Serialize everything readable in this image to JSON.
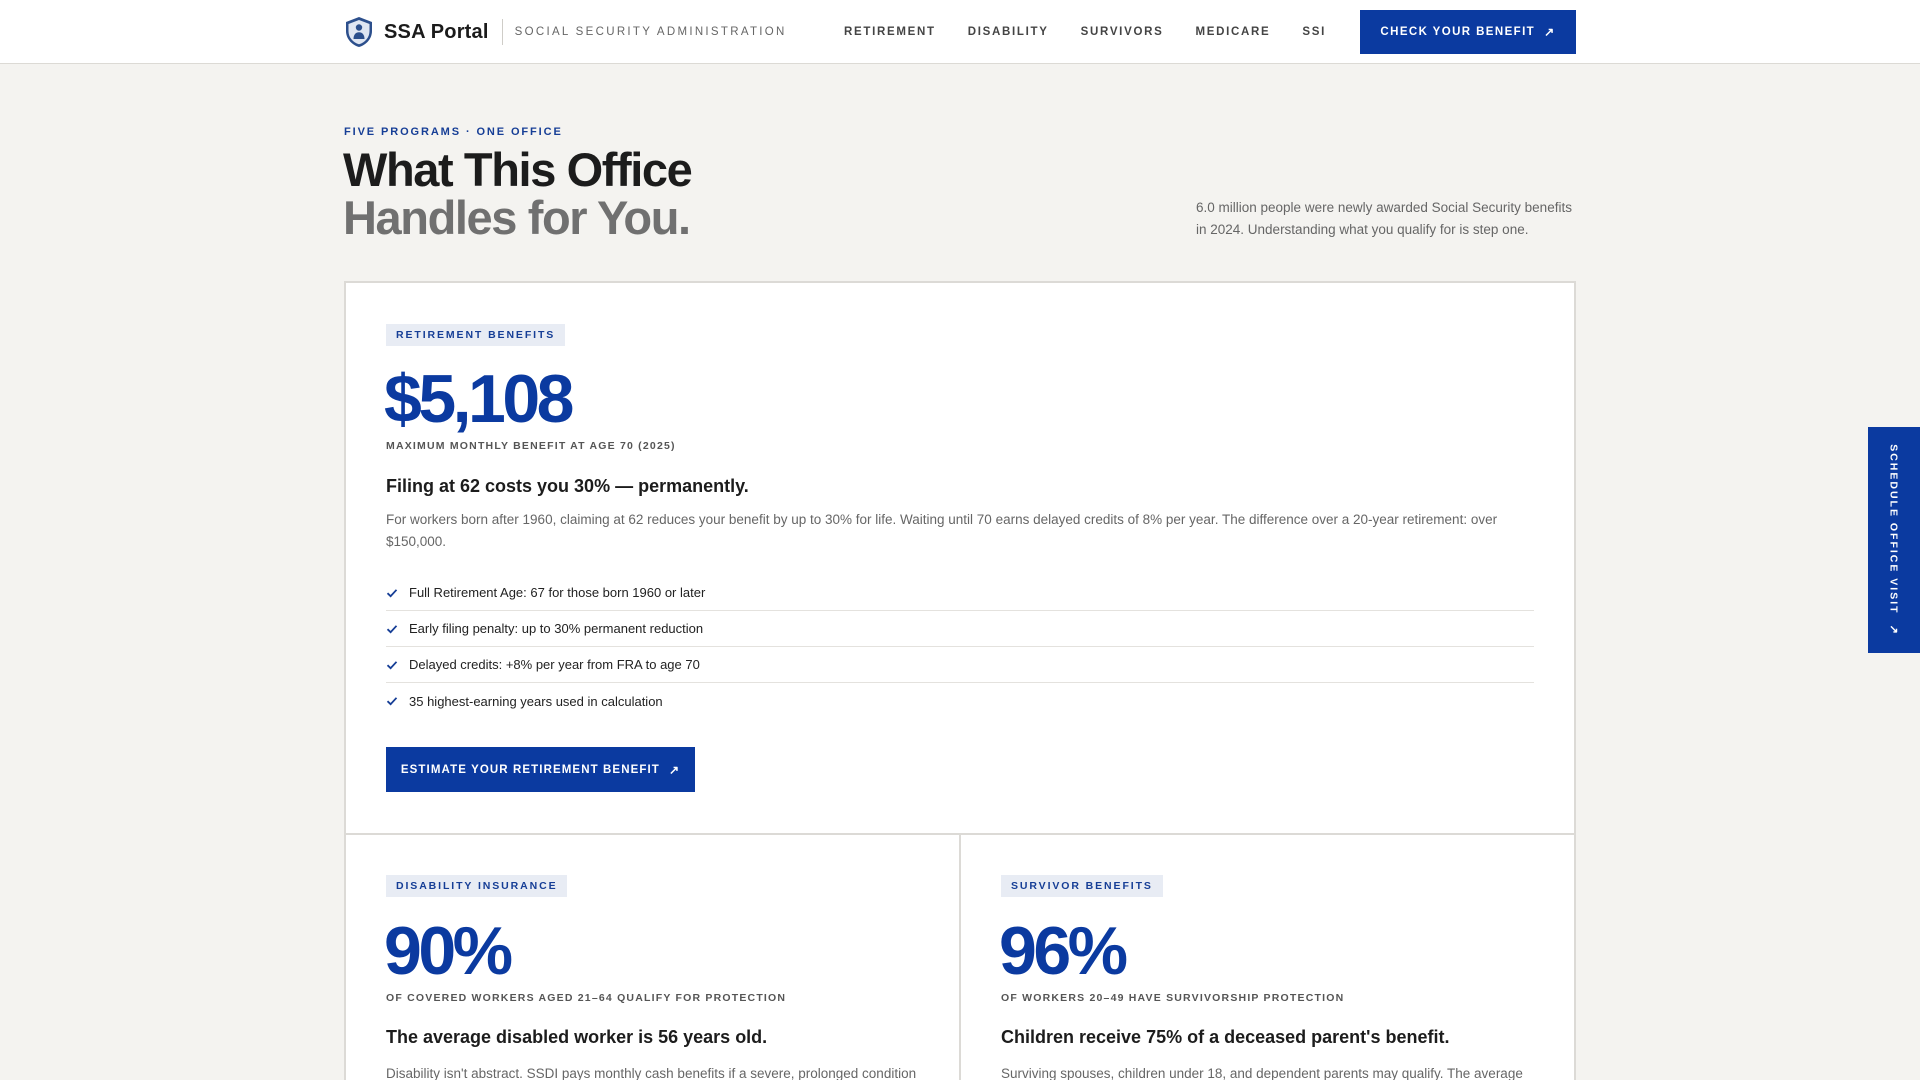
{
  "header": {
    "brand_name": "SSA Portal",
    "brand_subtitle": "SOCIAL SECURITY ADMINISTRATION",
    "logo_icon": "shield-person-icon",
    "nav": [
      "RETIREMENT",
      "DISABILITY",
      "SURVIVORS",
      "MEDICARE",
      "SSI"
    ],
    "cta_label": "CHECK YOUR BENEFIT",
    "cta_icon": "arrow-up-right-icon"
  },
  "hero": {
    "eyebrow": "FIVE PROGRAMS · ONE OFFICE",
    "title_line1": "What This Office",
    "title_line2": "Handles for You.",
    "intro": "6.0 million people were newly awarded Social Security benefits in 2024. Understanding what you qualify for is step one."
  },
  "cards": {
    "retirement": {
      "tag": "RETIREMENT BENEFITS",
      "stat": "$5,108",
      "stat_caption": "MAXIMUM MONTHLY BENEFIT AT AGE 70 (2025)",
      "headline": "Filing at 62 costs you 30% — permanently.",
      "body": "For workers born after 1960, claiming at 62 reduces your benefit by up to 30% for life. Waiting until 70 earns delayed credits of 8% per year. The difference over a 20-year retirement: over $150,000.",
      "checklist": [
        "Full Retirement Age: 67 for those born 1960 or later",
        "Early filing penalty: up to 30% permanent reduction",
        "Delayed credits: +8% per year from FRA to age 70",
        "35 highest-earning years used in calculation"
      ],
      "cta_label": "ESTIMATE YOUR RETIREMENT BENEFIT"
    },
    "disability": {
      "tag": "DISABILITY INSURANCE",
      "stat": "90%",
      "stat_caption": "OF COVERED WORKERS AGED 21–64 QUALIFY FOR PROTECTION",
      "headline": "The average disabled worker is 56 years old.",
      "body": "Disability isn't abstract. SSDI pays monthly cash benefits if a severe, prolonged condition"
    },
    "survivor": {
      "tag": "SURVIVOR BENEFITS",
      "stat": "96%",
      "stat_caption": "OF WORKERS 20–49 HAVE SURVIVORSHIP PROTECTION",
      "headline": "Children receive 75% of a deceased parent's benefit.",
      "body": "Surviving spouses, children under 18, and dependent parents may qualify. The average"
    }
  },
  "side_tab": {
    "label": "SCHEDULE OFFICE VISIT",
    "icon": "arrow-up-right-icon"
  },
  "colors": {
    "accent": "#0b3aa0",
    "background": "#f4f3f0",
    "tag_background": "#e8ecf4"
  }
}
